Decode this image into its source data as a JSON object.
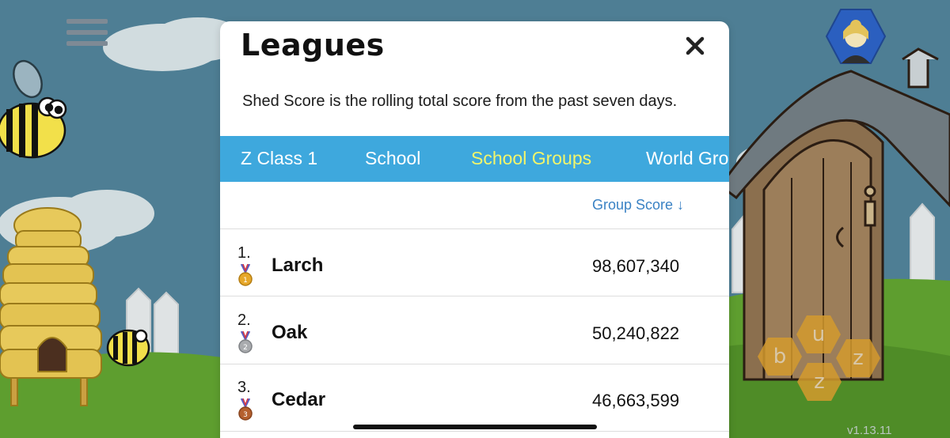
{
  "modal": {
    "title": "Leagues",
    "subtitle": "Shed Score is the rolling total score from the past seven days.",
    "tabs": [
      {
        "label": "Z Class 1",
        "active": false
      },
      {
        "label": "School",
        "active": false
      },
      {
        "label": "School Groups",
        "active": true
      },
      {
        "label": "World Gro",
        "active": false
      }
    ],
    "sort_header": "Group Score ↓",
    "rows": [
      {
        "rank": "1.",
        "name": "Larch",
        "score": "98,607,340",
        "medal": "gold"
      },
      {
        "rank": "2.",
        "name": "Oak",
        "score": "50,240,822",
        "medal": "silver"
      },
      {
        "rank": "3.",
        "name": "Cedar",
        "score": "46,663,599",
        "medal": "bronze"
      }
    ]
  },
  "game": {
    "letters": [
      "u",
      "b",
      "z",
      "z"
    ],
    "version": "v1.13.11"
  },
  "icons": {
    "menu": "hamburger-menu-icon",
    "avatar": "user-avatar-icon",
    "close": "close-icon"
  },
  "colors": {
    "tab_bar": "#3ea8dd",
    "active_tab": "#f2f56b",
    "link": "#3a82c4",
    "gold": "#e7a82a",
    "silver": "#a9abae",
    "bronze": "#b5602e",
    "sky": "#4e7e94",
    "grass": "#5e9e2f"
  }
}
